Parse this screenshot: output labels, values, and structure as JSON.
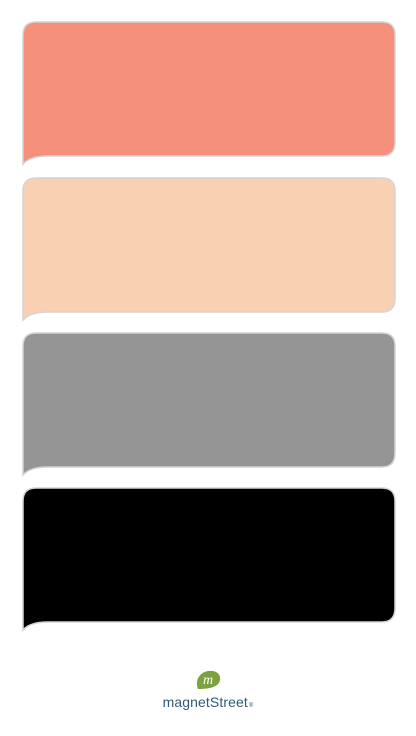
{
  "swatches": [
    {
      "name": "salmon",
      "color": "#F4907B"
    },
    {
      "name": "peach",
      "color": "#F9D1B2"
    },
    {
      "name": "gray",
      "color": "#949594"
    },
    {
      "name": "black",
      "color": "#000000"
    }
  ],
  "logo": {
    "brand": "magnetStreet",
    "trademark": "®",
    "mark_letter": "m",
    "mark_color": "#7BA23F",
    "text_color": "#2F5B74"
  }
}
